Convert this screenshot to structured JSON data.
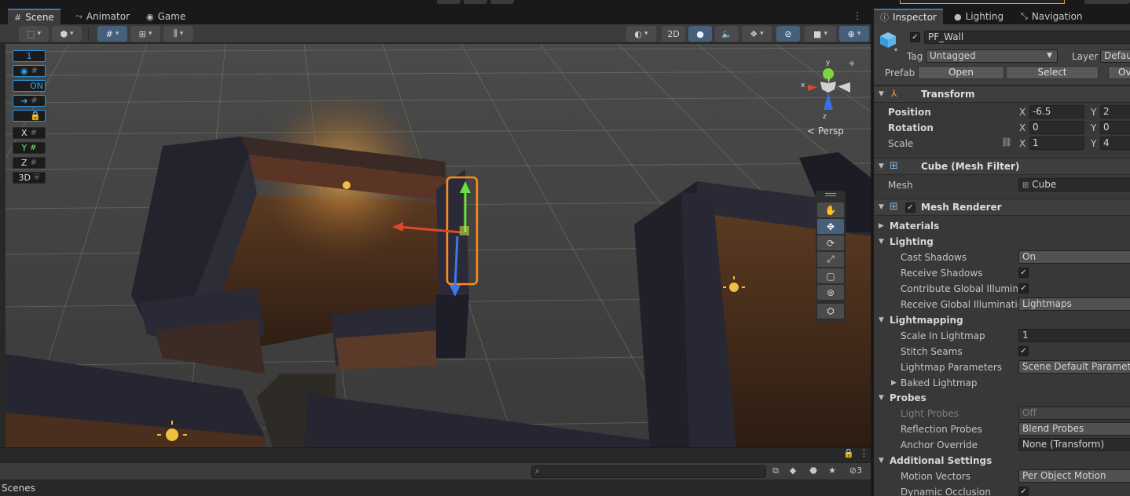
{
  "scene_tabs": [
    {
      "label": "Scene",
      "icon": "scene-grid-icon"
    },
    {
      "label": "Animator",
      "icon": "animator-icon"
    },
    {
      "label": "Game",
      "icon": "game-controller-icon"
    }
  ],
  "scene_toolbar": {
    "mode_2d": "2D"
  },
  "overlay": {
    "grid_value": "1",
    "on_label": "ON",
    "axis_x": "X",
    "axis_y": "Y",
    "axis_z": "Z",
    "mode_3d": "3D"
  },
  "gizmo": {
    "x": "x",
    "y": "y",
    "z": "z",
    "projection": "Persp"
  },
  "project": {
    "section": "Scenes",
    "hidden_count": "3"
  },
  "inspector": {
    "tabs": [
      {
        "label": "Inspector",
        "icon": "info-icon"
      },
      {
        "label": "Lighting",
        "icon": "lightbulb-icon"
      },
      {
        "label": "Navigation",
        "icon": "navigation-icon"
      }
    ],
    "object": {
      "name": "PF_Wall",
      "active": true,
      "tag_label": "Tag",
      "tag_value": "Untagged",
      "layer_label": "Layer",
      "layer_value": "Defau",
      "prefab_label": "Prefab",
      "prefab_open": "Open",
      "prefab_select": "Select",
      "prefab_overrides": "Ove"
    },
    "transform": {
      "title": "Transform",
      "position_label": "Position",
      "rotation_label": "Rotation",
      "scale_label": "Scale",
      "axis_x": "X",
      "axis_y": "Y",
      "position": {
        "x": "-6.5",
        "y": "2"
      },
      "rotation": {
        "x": "0",
        "y": "0"
      },
      "scale": {
        "x": "1",
        "y": "4"
      }
    },
    "mesh_filter": {
      "title": "Cube (Mesh Filter)",
      "mesh_label": "Mesh",
      "mesh_value": "Cube"
    },
    "mesh_renderer": {
      "title": "Mesh Renderer",
      "enabled": true,
      "materials": "Materials",
      "lighting": "Lighting",
      "cast_shadows_label": "Cast Shadows",
      "cast_shadows_value": "On",
      "receive_shadows_label": "Receive Shadows",
      "contribute_gi_label": "Contribute Global Illuminat",
      "receive_gi_label": "Receive Global Illumination",
      "receive_gi_value": "Lightmaps",
      "lightmapping": "Lightmapping",
      "scale_in_lightmap_label": "Scale In Lightmap",
      "scale_in_lightmap_value": "1",
      "stitch_seams_label": "Stitch Seams",
      "lightmap_params_label": "Lightmap Parameters",
      "lightmap_params_value": "Scene Default Parameter",
      "baked_lightmap": "Baked Lightmap",
      "probes": "Probes",
      "light_probes_label": "Light Probes",
      "light_probes_value": "Off",
      "reflection_probes_label": "Reflection Probes",
      "reflection_probes_value": "Blend Probes",
      "anchor_override_label": "Anchor Override",
      "anchor_override_value": "None (Transform)",
      "additional_settings": "Additional Settings",
      "motion_vectors_label": "Motion Vectors",
      "motion_vectors_value": "Per Object Motion",
      "dynamic_occlusion_label": "Dynamic Occlusion"
    }
  }
}
